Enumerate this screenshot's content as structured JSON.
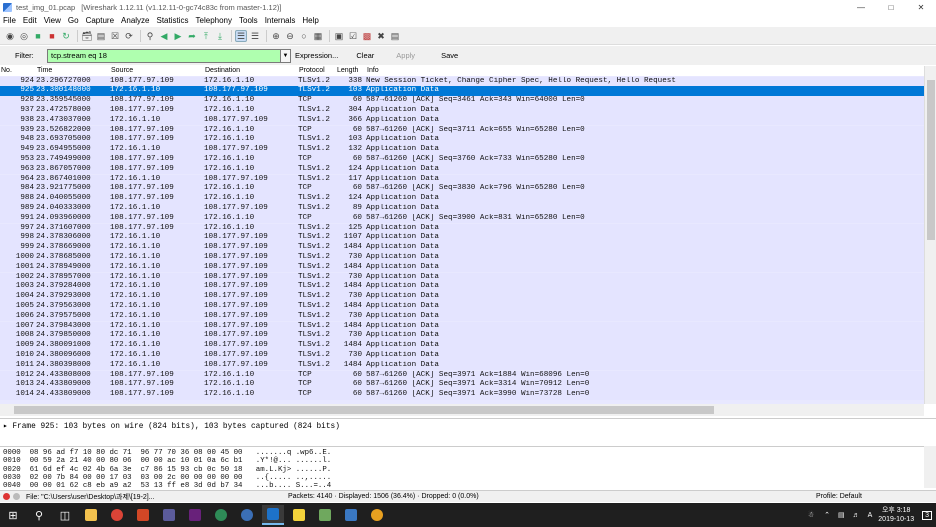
{
  "window": {
    "title_file": "test_img_01.pcap",
    "title_app": "[Wireshark 1.12.11  (v1.12.11-0-gc74c83c from master-1.12)]"
  },
  "menu": [
    "File",
    "Edit",
    "View",
    "Go",
    "Capture",
    "Analyze",
    "Statistics",
    "Telephony",
    "Tools",
    "Internals",
    "Help"
  ],
  "filter": {
    "label": "Filter:",
    "value": "tcp.stream eq 18",
    "expression": "Expression...",
    "clear": "Clear",
    "apply": "Apply",
    "save": "Save"
  },
  "columns": {
    "no": "No.",
    "time": "Time",
    "source": "Source",
    "destination": "Destination",
    "protocol": "Protocol",
    "length": "Length",
    "info": "Info"
  },
  "packets": [
    [
      "924",
      "23.296727000",
      "108.177.97.109",
      "172.16.1.10",
      "TLSv1.2",
      "338",
      "New Session Ticket, Change Cipher Spec, Hello Request, Hello Request"
    ],
    [
      "925",
      "23.300148000",
      "172.16.1.10",
      "108.177.97.109",
      "TLSv1.2",
      "103",
      "Application Data"
    ],
    [
      "928",
      "23.359545000",
      "108.177.97.109",
      "172.16.1.10",
      "TCP",
      "60",
      "587→61260 [ACK] Seq=3461 Ack=343 Win=64000 Len=0"
    ],
    [
      "937",
      "23.472578000",
      "108.177.97.109",
      "172.16.1.10",
      "TLSv1.2",
      "304",
      "Application Data"
    ],
    [
      "938",
      "23.473037000",
      "172.16.1.10",
      "108.177.97.109",
      "TLSv1.2",
      "366",
      "Application Data"
    ],
    [
      "939",
      "23.526822000",
      "108.177.97.109",
      "172.16.1.10",
      "TCP",
      "60",
      "587→61260 [ACK] Seq=3711 Ack=655 Win=65280 Len=0"
    ],
    [
      "948",
      "23.693705000",
      "108.177.97.109",
      "172.16.1.10",
      "TLSv1.2",
      "103",
      "Application Data"
    ],
    [
      "949",
      "23.694955000",
      "172.16.1.10",
      "108.177.97.109",
      "TLSv1.2",
      "132",
      "Application Data"
    ],
    [
      "953",
      "23.749499000",
      "108.177.97.109",
      "172.16.1.10",
      "TCP",
      "60",
      "587→61260 [ACK] Seq=3760 Ack=733 Win=65280 Len=0"
    ],
    [
      "963",
      "23.867057000",
      "108.177.97.109",
      "172.16.1.10",
      "TLSv1.2",
      "124",
      "Application Data"
    ],
    [
      "964",
      "23.867401000",
      "172.16.1.10",
      "108.177.97.109",
      "TLSv1.2",
      "117",
      "Application Data"
    ],
    [
      "984",
      "23.921775000",
      "108.177.97.109",
      "172.16.1.10",
      "TCP",
      "60",
      "587→61260 [ACK] Seq=3830 Ack=796 Win=65280 Len=0"
    ],
    [
      "988",
      "24.040055000",
      "108.177.97.109",
      "172.16.1.10",
      "TLSv1.2",
      "124",
      "Application Data"
    ],
    [
      "989",
      "24.040333000",
      "172.16.1.10",
      "108.177.97.109",
      "TLSv1.2",
      "89",
      "Application Data"
    ],
    [
      "991",
      "24.093960000",
      "108.177.97.109",
      "172.16.1.10",
      "TCP",
      "60",
      "587→61260 [ACK] Seq=3900 Ack=831 Win=65280 Len=0"
    ],
    [
      "997",
      "24.371607000",
      "108.177.97.109",
      "172.16.1.10",
      "TLSv1.2",
      "125",
      "Application Data"
    ],
    [
      "998",
      "24.378306000",
      "172.16.1.10",
      "108.177.97.109",
      "TLSv1.2",
      "1107",
      "Application Data"
    ],
    [
      "999",
      "24.378669000",
      "172.16.1.10",
      "108.177.97.109",
      "TLSv1.2",
      "1484",
      "Application Data"
    ],
    [
      "1000",
      "24.378685000",
      "172.16.1.10",
      "108.177.97.109",
      "TLSv1.2",
      "730",
      "Application Data"
    ],
    [
      "1001",
      "24.378949000",
      "172.16.1.10",
      "108.177.97.109",
      "TLSv1.2",
      "1484",
      "Application Data"
    ],
    [
      "1002",
      "24.378957000",
      "172.16.1.10",
      "108.177.97.109",
      "TLSv1.2",
      "730",
      "Application Data"
    ],
    [
      "1003",
      "24.379284000",
      "172.16.1.10",
      "108.177.97.109",
      "TLSv1.2",
      "1484",
      "Application Data"
    ],
    [
      "1004",
      "24.379293000",
      "172.16.1.10",
      "108.177.97.109",
      "TLSv1.2",
      "730",
      "Application Data"
    ],
    [
      "1005",
      "24.379563000",
      "172.16.1.10",
      "108.177.97.109",
      "TLSv1.2",
      "1484",
      "Application Data"
    ],
    [
      "1006",
      "24.379575000",
      "172.16.1.10",
      "108.177.97.109",
      "TLSv1.2",
      "730",
      "Application Data"
    ],
    [
      "1007",
      "24.379843000",
      "172.16.1.10",
      "108.177.97.109",
      "TLSv1.2",
      "1484",
      "Application Data"
    ],
    [
      "1008",
      "24.379850000",
      "172.16.1.10",
      "108.177.97.109",
      "TLSv1.2",
      "730",
      "Application Data"
    ],
    [
      "1009",
      "24.380091000",
      "172.16.1.10",
      "108.177.97.109",
      "TLSv1.2",
      "1484",
      "Application Data"
    ],
    [
      "1010",
      "24.380096000",
      "172.16.1.10",
      "108.177.97.109",
      "TLSv1.2",
      "730",
      "Application Data"
    ],
    [
      "1011",
      "24.380398000",
      "172.16.1.10",
      "108.177.97.109",
      "TLSv1.2",
      "1484",
      "Application Data"
    ],
    [
      "1012",
      "24.433808000",
      "108.177.97.109",
      "172.16.1.10",
      "TCP",
      "60",
      "587→61260 [ACK] Seq=3971 Ack=1884 Win=68096 Len=0"
    ],
    [
      "1013",
      "24.433809000",
      "108.177.97.109",
      "172.16.1.10",
      "TCP",
      "60",
      "587→61260 [ACK] Seq=3971 Ack=3314 Win=70912 Len=0"
    ],
    [
      "1014",
      "24.433809000",
      "108.177.97.109",
      "172.16.1.10",
      "TCP",
      "60",
      "587→61260 [ACK] Seq=3971 Ack=3990 Win=73728 Len=0"
    ]
  ],
  "selected_packet": "925",
  "details": {
    "line": "Frame 925: 103 bytes on wire (824 bits), 103 bytes captured (824 bits)"
  },
  "bytes": [
    "0000  08 96 ad f7 10 80 dc 71  96 77 70 36 08 00 45 00   .......q .wp6..E.",
    "0010  00 59 2a 21 40 00 80 06  00 00 ac 10 01 0a 6c b1   .Y*!@... ......l.",
    "0020  61 6d ef 4c 02 4b 6a 3e  c7 86 15 93 cb 0c 50 18   am.L.Kj> ......P.",
    "0030  02 00 7b 84 00 00 17 03  03 00 2c 00 00 00 00 00   ..{..... ..,.....",
    "0040  00 00 01 62 c8 eb a9 a2  53 13 ff e8 3d 0d b7 34   ...b.... S...=..4"
  ],
  "status": {
    "file": "File: \"C:\\Users\\user\\Desktop\\과제\\[19-2]...",
    "packets": "Packets: 4140 · Displayed: 1506 (36.4%) · Dropped: 0 (0.0%)",
    "profile": "Profile: Default"
  },
  "taskbar": {
    "time": "오후 3:18",
    "date": "2019-10-13",
    "lang": "A",
    "notif": "3"
  },
  "colors": {
    "row_bg": "#e4e4ff",
    "selected": "#0078d7",
    "filter_ok": "#afffaf"
  }
}
